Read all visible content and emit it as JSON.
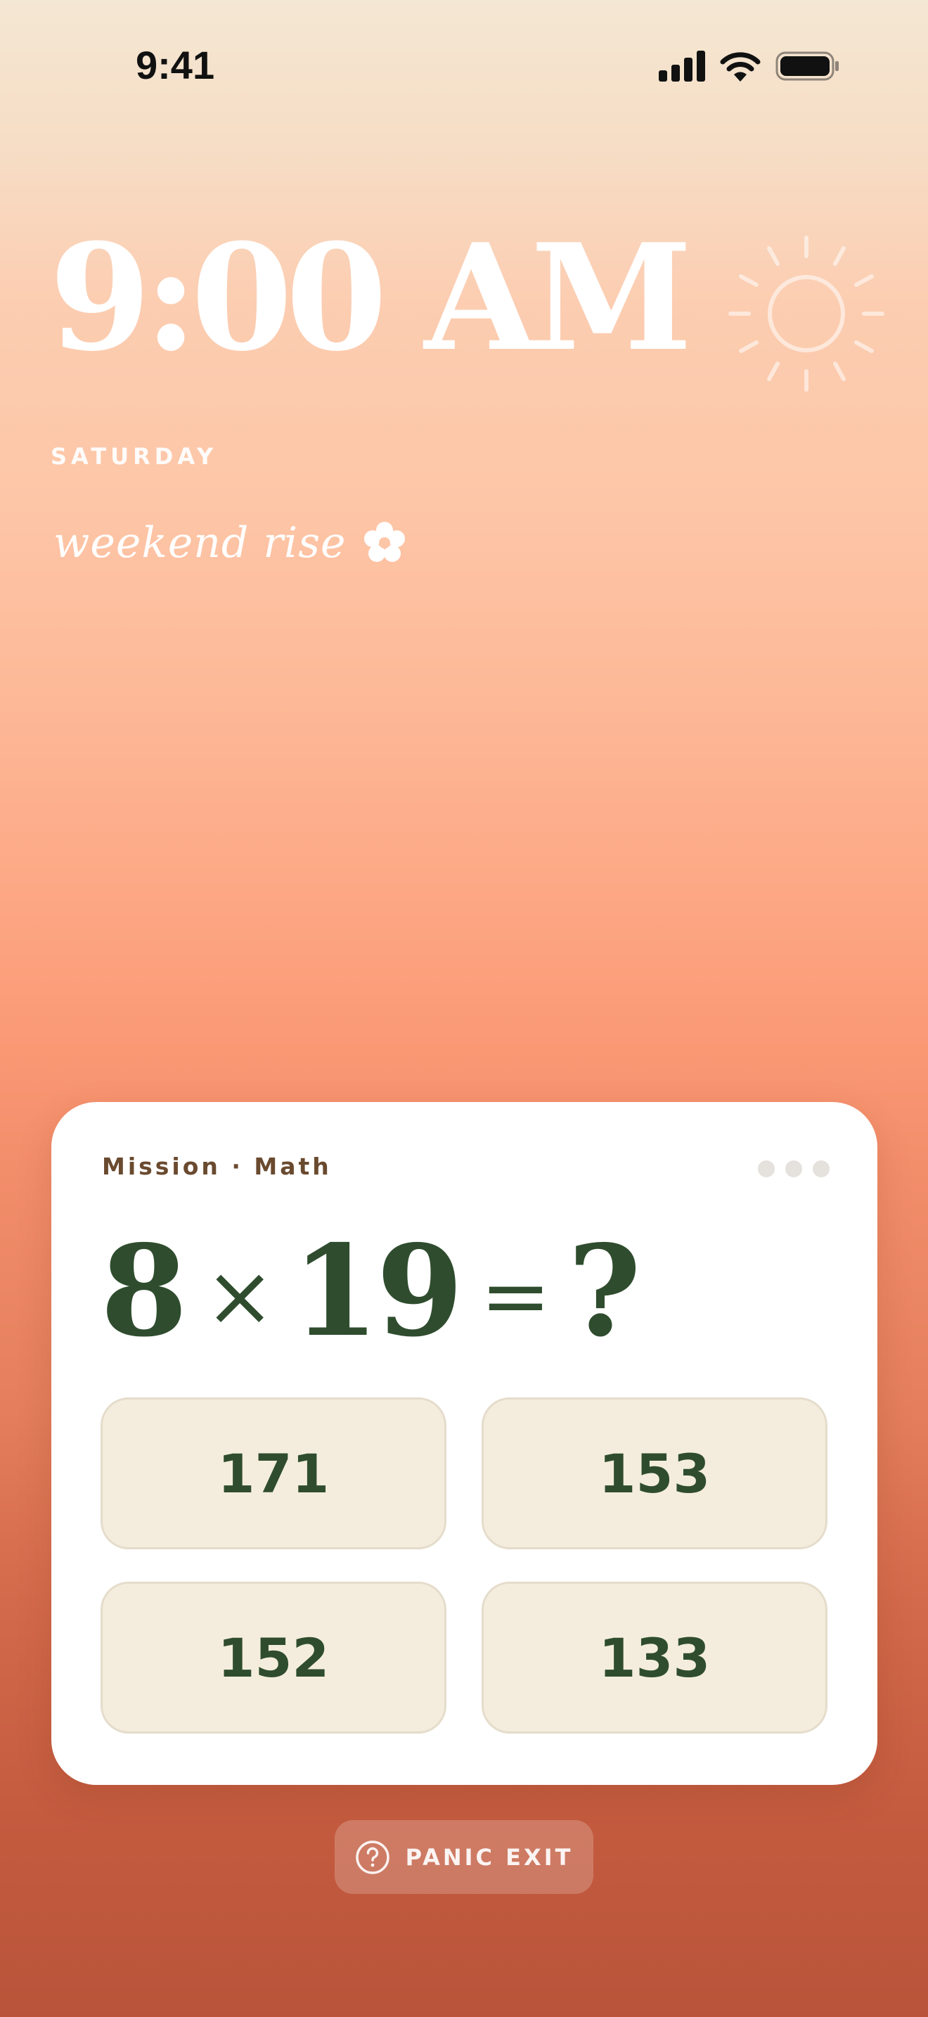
{
  "status_bar": {
    "time": "9:41",
    "icons": [
      "cellular-signal-icon",
      "wifi-icon",
      "battery-icon"
    ]
  },
  "alarm": {
    "time": "9:00 AM",
    "day": "SATURDAY",
    "tagline": "weekend rise",
    "weather_icon": "sun-icon",
    "tagline_icon": "flower-icon"
  },
  "mission": {
    "label": "Mission · Math",
    "menu_icon": "more-dots-icon",
    "question": {
      "left": "8",
      "operator": "×",
      "right": "19",
      "equals": "=",
      "unknown": "?"
    },
    "answers": [
      "171",
      "153",
      "152",
      "133"
    ]
  },
  "panic_exit": {
    "label": "PANIC EXIT",
    "icon": "question-circle-icon"
  },
  "colors": {
    "accent_green": "#2f4d2e",
    "answer_fill": "#f4eddd",
    "label_brown": "#6a4a2f",
    "background_top": "#f4e7d3",
    "background_bottom": "#b9543a"
  }
}
